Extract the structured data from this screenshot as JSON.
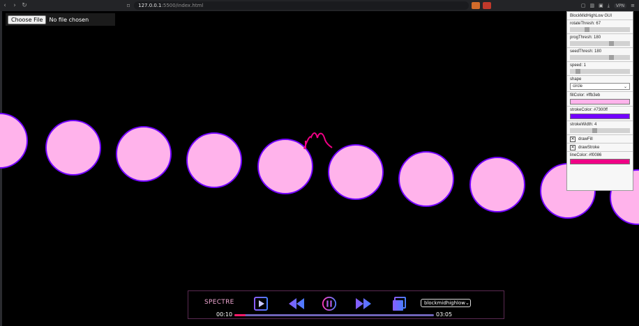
{
  "browser": {
    "url_host": "127.0.0.1",
    "url_rest": ":5500/index.html",
    "vpn_label": "VPN"
  },
  "file_input": {
    "button_label": "Choose File",
    "status": "No file chosen"
  },
  "gui": {
    "title": "BlockMidHighLow GUI",
    "rotateThresh": {
      "label": "rotateThresh: 67",
      "value": 67,
      "max": 255
    },
    "progThresh": {
      "label": "progThresh: 180",
      "value": 180,
      "max": 255
    },
    "seedThresh": {
      "label": "seedThresh: 180",
      "value": 180,
      "max": 255
    },
    "speed": {
      "label": "speed: 1",
      "value": 1,
      "max": 10
    },
    "shape": {
      "label": "shape",
      "value": "circle"
    },
    "fillColor": {
      "label": "fillColor: #ffb3eb",
      "value": "#ffb3eb"
    },
    "strokeColor": {
      "label": "strokeColor: #7300ff",
      "value": "#7300ff"
    },
    "strokeWidth": {
      "label": "strokeWidth: 4",
      "value": 4,
      "max": 10
    },
    "drawFill": {
      "label": "drawFill",
      "checked": true
    },
    "drawStroke": {
      "label": "drawStroke",
      "checked": true
    },
    "lineColor": {
      "label": "lineColor: #f0086",
      "value": "#f00086"
    }
  },
  "player": {
    "brand": "SPECTRE",
    "preset_select": "blockmidhighlow",
    "current_time": "00:10",
    "total_time": "03:05",
    "progress_fraction": 0.055
  },
  "colors": {
    "circle_fill": "#ffb3eb",
    "circle_stroke": "#7300ff",
    "line": "#f00086",
    "accent_gradient": [
      "#7b5cff",
      "#4a7dff"
    ]
  }
}
